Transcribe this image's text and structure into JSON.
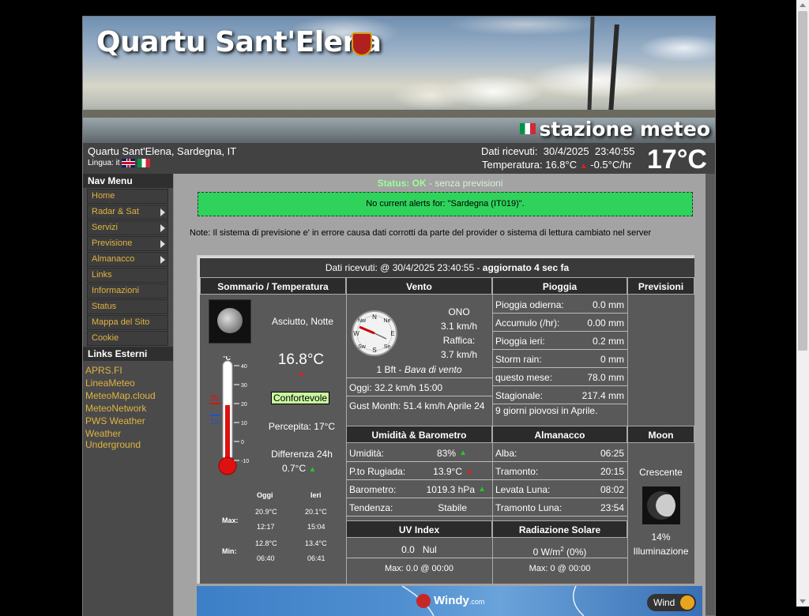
{
  "banner": {
    "title": "Quartu Sant'Elena",
    "subtitle": "stazione meteo"
  },
  "info": {
    "location": "Quartu Sant'Elena, Sardegna, IT",
    "lang_label": "Lingua: it",
    "received_label": "Dati ricevuti:",
    "received_date": "30/4/2025",
    "received_time": "23:40:55",
    "temp_label": "Temperatura:",
    "temp_value": "16.8°C",
    "temp_rate": "-0.5°C/hr",
    "big_temp": "17°C"
  },
  "nav": {
    "header": "Nav Menu",
    "items": [
      {
        "label": "Home",
        "sub": false
      },
      {
        "label": "Radar & Sat",
        "sub": true
      },
      {
        "label": "Servizi",
        "sub": true
      },
      {
        "label": "Previsione",
        "sub": true
      },
      {
        "label": "Almanacco",
        "sub": true
      },
      {
        "label": "Links",
        "sub": false
      },
      {
        "label": "Informazioni",
        "sub": false
      },
      {
        "label": "Status",
        "sub": false
      },
      {
        "label": "Mappa del Sito",
        "sub": false
      },
      {
        "label": "Cookie",
        "sub": false
      }
    ],
    "ext_header": "Links Esterni",
    "ext_links": [
      "APRS.FI",
      "LineaMeteo",
      "MeteoMap.cloud",
      "MeteoNetwork",
      "PWS Weather",
      "Weather Underground"
    ]
  },
  "status": {
    "label": "Status: OK",
    "sub": "- senza previsioni"
  },
  "alert": "No current alerts for: \"Sardegna (IT019)\".",
  "note": "Note: Il sistema di previsione e' in errore causa dati corrotti da parte del provider o sistema di lettura cambiato nel server",
  "panel": {
    "title_prefix": "Dati ricevuti: @ 30/4/2025 23:40:55 - ",
    "title_bold": "aggiornato 4 sec fa",
    "heads": {
      "summary": "Sommario / Temperatura",
      "wind": "Vento",
      "rain": "Pioggia",
      "forecast": "Previsioni",
      "humidity": "Umidità & Barometro",
      "almanac": "Almanacco",
      "moon": "Moon",
      "uv": "UV Index",
      "solar": "Radiazione Solare"
    },
    "summary": {
      "condition": "Asciutto, Notte",
      "temp": "16.8°C",
      "comfort": "Confortevole",
      "feels": "Percepita: 17°C",
      "diff_label": "Differenza 24h",
      "diff_value": "0.7°C",
      "thermo_hi": "20",
      "thermo_lo": "13",
      "thermo_scale": [
        "40",
        "30",
        "20",
        "10",
        "0",
        "-10"
      ],
      "minmax": {
        "today": "Oggi",
        "yesterday": "Ieri",
        "max_label": "Max:",
        "min_label": "Min:",
        "max_today": "20.9°C",
        "max_today_time": "12:17",
        "max_yest": "20.1°C",
        "max_yest_time": "15:04",
        "min_today": "12.8°C",
        "min_today_time": "06:40",
        "min_yest": "13.4°C",
        "min_yest_time": "06:41"
      }
    },
    "wind": {
      "dir": "ONO",
      "speed": "3.1 km/h",
      "gust_label": "Raffica:",
      "gust": "3.7 km/h",
      "bft": "1 Bft - ",
      "bft_desc": "Bava di vento",
      "today": "Oggi: 32.2 km/h 15:00",
      "gust_month": "Gust Month: 51.4 km/h Aprile 24",
      "compass": {
        "n": "N",
        "ne": "Ne",
        "nw": "Nw",
        "e": "E",
        "w": "W",
        "se": "Se",
        "sw": "Sw",
        "s": "S"
      }
    },
    "rain": [
      {
        "label": "Pioggia odierna:",
        "value": "0.0 mm"
      },
      {
        "label": "Accumulo (/hr):",
        "value": "0.00 mm"
      },
      {
        "label": "Pioggia ieri:",
        "value": "0.2 mm"
      },
      {
        "label": "Storm rain:",
        "value": "0 mm"
      },
      {
        "label": "questo mese:",
        "value": "78.0 mm"
      },
      {
        "label": "Stagionale:",
        "value": "217.4 mm"
      }
    ],
    "rain_days": "9 giorni piovosi in Aprile.",
    "humidity": [
      {
        "label": "Umidità:",
        "value": "83%"
      },
      {
        "label": "P.to Rugiada:",
        "value": "13.9°C"
      },
      {
        "label": "Barometro:",
        "value": "1019.3 hPa"
      },
      {
        "label": "Tendenza:",
        "value": "Stabile"
      }
    ],
    "almanac": [
      {
        "label": "Alba:",
        "value": "06:25"
      },
      {
        "label": "Tramonto:",
        "value": "20:15"
      },
      {
        "label": "Levata Luna:",
        "value": "08:02"
      },
      {
        "label": "Tramonto Luna:",
        "value": "23:54"
      }
    ],
    "moon": {
      "phase": "Crescente",
      "illum_pct": "14%",
      "illum_label": "Illuminazione"
    },
    "uv": {
      "value": "0.0",
      "desc": "Nul",
      "max": "Max: 0.0 @ 00:00"
    },
    "solar": {
      "value": "0 W/m",
      "sup": "2",
      "pct": " (0%)",
      "max": "Max: 0 @  00:00"
    }
  },
  "windy": {
    "brand": "Windy",
    "domain": ".com",
    "button": "Wind"
  }
}
